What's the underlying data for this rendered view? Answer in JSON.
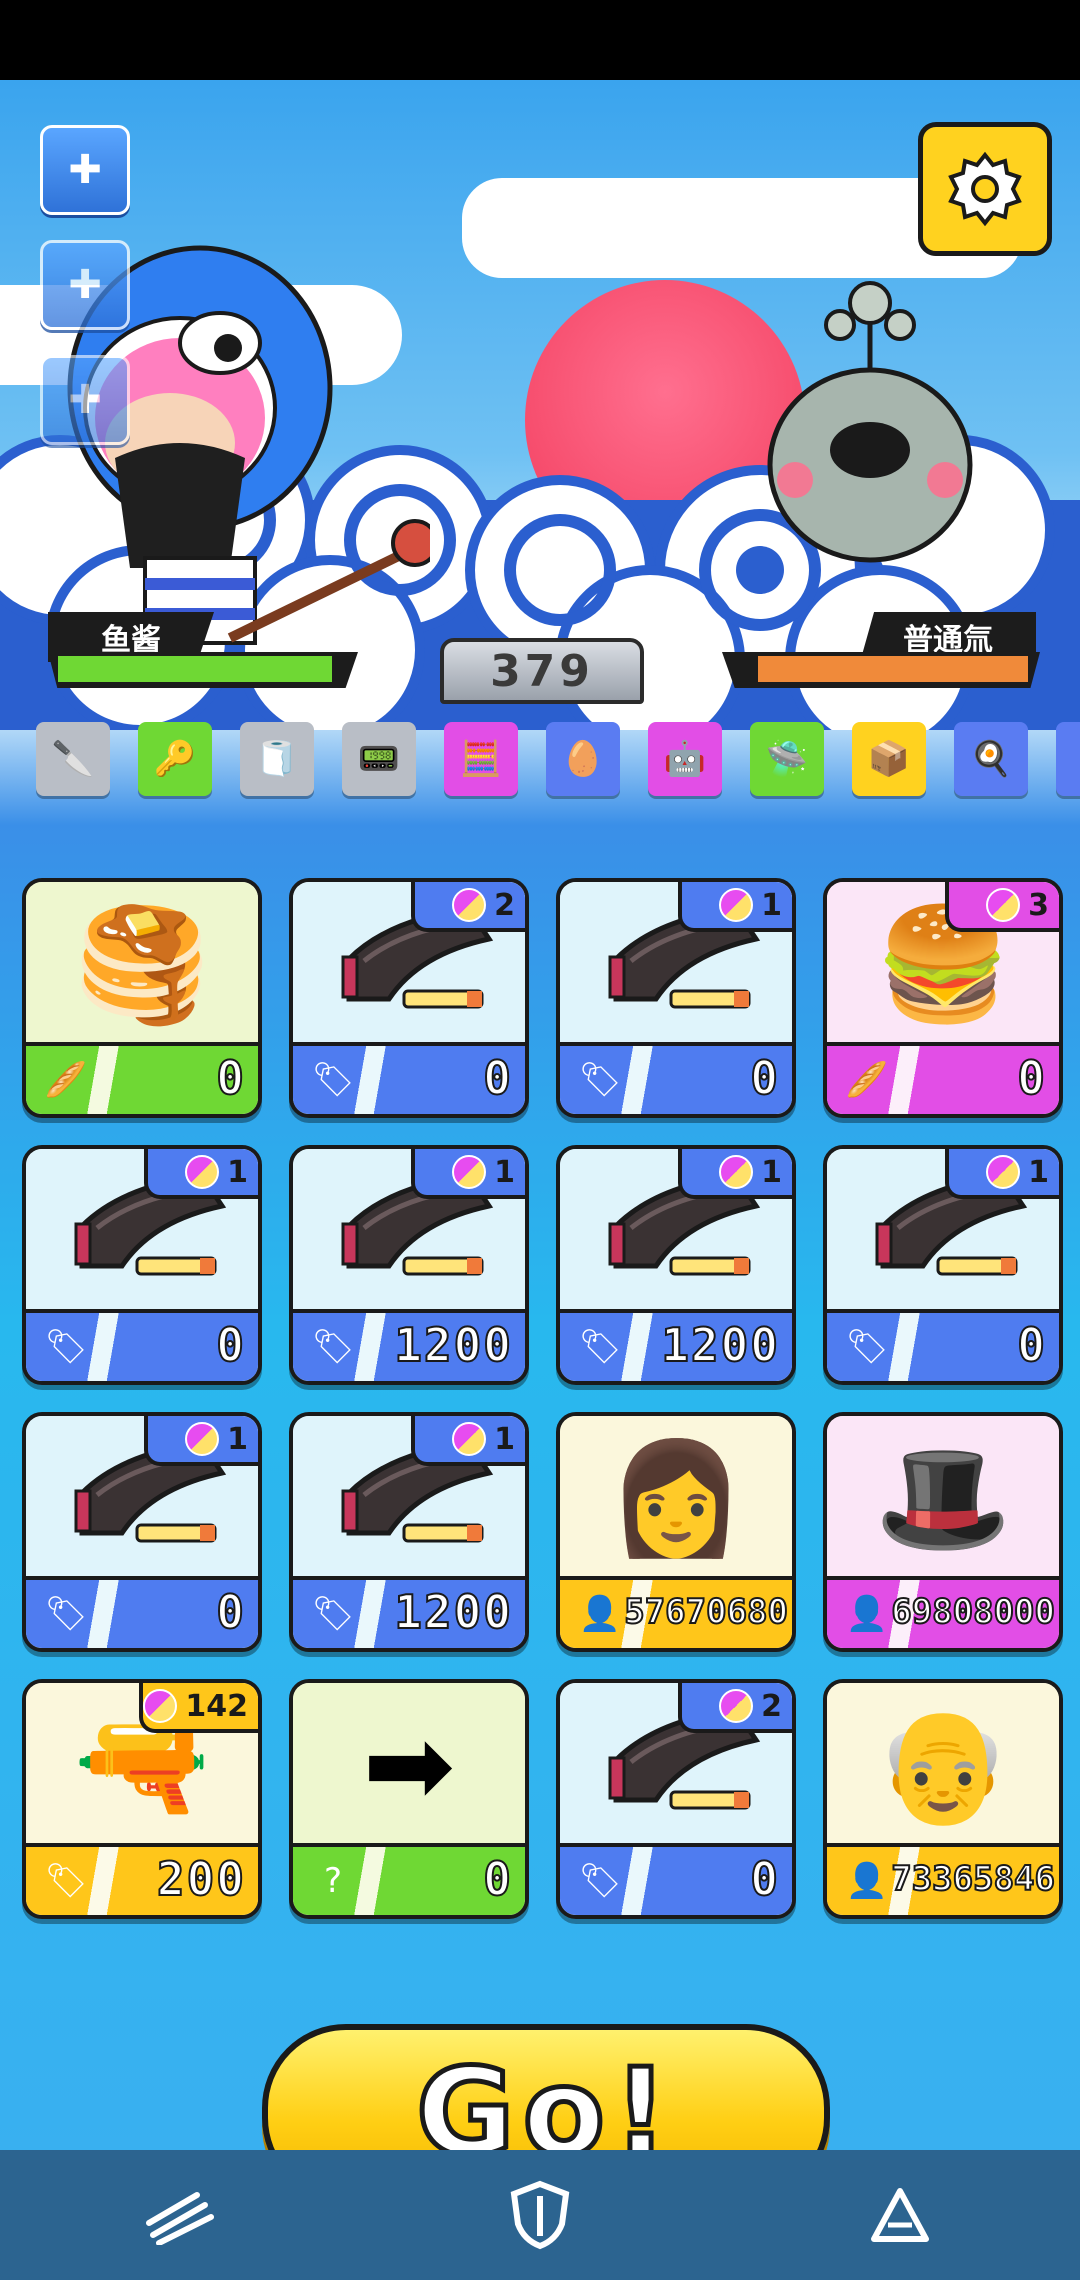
{
  "game": {
    "player_name": "鱼酱",
    "enemy_name": "普通氚",
    "score": "379",
    "player_hp_fraction": 0.95,
    "enemy_hp_fraction": 0.93,
    "go_label": "Go!"
  },
  "side_buttons": [
    {
      "name": "add-button-1",
      "icon": "plus-icon"
    },
    {
      "name": "add-button-2",
      "icon": "plus-icon"
    },
    {
      "name": "add-button-3",
      "icon": "plus-icon"
    }
  ],
  "tools": [
    {
      "name": "cleaver-tool",
      "glyph": "🔪",
      "color": "#b9bec6"
    },
    {
      "name": "key-tool",
      "glyph": "🔑",
      "color": "#6fd834"
    },
    {
      "name": "roll-tool",
      "glyph": "🧻",
      "color": "#b9bec6"
    },
    {
      "name": "circuit-tool",
      "glyph": "📟",
      "color": "#b9bec6"
    },
    {
      "name": "calculator-tool",
      "glyph": "🧮",
      "color": "#e24ee6"
    },
    {
      "name": "nest-tool",
      "glyph": "🥚",
      "color": "#5a7cf2"
    },
    {
      "name": "robot-tool",
      "glyph": "🤖",
      "color": "#e24ee6"
    },
    {
      "name": "drone-tool",
      "glyph": "🛸",
      "color": "#6fd834"
    },
    {
      "name": "ammo-box-tool",
      "glyph": "📦",
      "color": "#ffd21f"
    },
    {
      "name": "pan-tool",
      "glyph": "🍳",
      "color": "#5a7cf2"
    },
    {
      "name": "extra-tool",
      "glyph": "🧃",
      "color": "#5a7cf2"
    }
  ],
  "cards": [
    {
      "name": "pancake-card",
      "theme": "green",
      "art": "🥞",
      "icon": "bread-icon",
      "icon_glyph": "🥖",
      "value": "0",
      "badge": ""
    },
    {
      "name": "magazine-card",
      "theme": "blue",
      "art": "mag",
      "icon": "tag-icon",
      "icon_glyph": "🏷",
      "value": "0",
      "badge": "2"
    },
    {
      "name": "magazine-card",
      "theme": "blue",
      "art": "mag",
      "icon": "tag-icon",
      "icon_glyph": "🏷",
      "value": "0",
      "badge": "1"
    },
    {
      "name": "burger-card",
      "theme": "pink",
      "art": "🍔",
      "icon": "bread-icon",
      "icon_glyph": "🥖",
      "value": "0",
      "badge": "3"
    },
    {
      "name": "magazine-card",
      "theme": "blue",
      "art": "mag",
      "icon": "tag-icon",
      "icon_glyph": "🏷",
      "value": "0",
      "badge": "1"
    },
    {
      "name": "magazine-card",
      "theme": "blue",
      "art": "mag",
      "icon": "tag-icon",
      "icon_glyph": "🏷",
      "value": "1200",
      "badge": "1"
    },
    {
      "name": "magazine-card",
      "theme": "blue",
      "art": "mag",
      "icon": "tag-icon",
      "icon_glyph": "🏷",
      "value": "1200",
      "badge": "1"
    },
    {
      "name": "magazine-card",
      "theme": "blue",
      "art": "mag",
      "icon": "tag-icon",
      "icon_glyph": "🏷",
      "value": "0",
      "badge": "1"
    },
    {
      "name": "magazine-card",
      "theme": "blue",
      "art": "mag",
      "icon": "tag-icon",
      "icon_glyph": "🏷",
      "value": "0",
      "badge": "1"
    },
    {
      "name": "magazine-card",
      "theme": "blue",
      "art": "mag",
      "icon": "tag-icon",
      "icon_glyph": "🏷",
      "value": "1200",
      "badge": "1"
    },
    {
      "name": "girl-character-card",
      "theme": "yellow",
      "art": "👩",
      "icon": "person-icon",
      "icon_glyph": "👤",
      "value": "57670680",
      "badge": ""
    },
    {
      "name": "gentleman-character-card",
      "theme": "pink",
      "art": "🎩",
      "icon": "person-icon",
      "icon_glyph": "👤",
      "value": "69808000",
      "badge": ""
    },
    {
      "name": "gatling-gun-card",
      "theme": "yellow",
      "art": "🔫",
      "icon": "tag-icon",
      "icon_glyph": "🏷",
      "value": "200",
      "badge": "142"
    },
    {
      "name": "red-arrow-card",
      "theme": "green",
      "art": "➡",
      "icon": "question-icon",
      "icon_glyph": "?",
      "value": "0",
      "badge": ""
    },
    {
      "name": "magazine-card",
      "theme": "blue",
      "art": "mag",
      "icon": "tag-icon",
      "icon_glyph": "🏷",
      "value": "0",
      "badge": "2"
    },
    {
      "name": "scientist-character-card",
      "theme": "yellow",
      "art": "👴",
      "icon": "person-icon",
      "icon_glyph": "👤",
      "value": "73365846",
      "badge": ""
    }
  ],
  "themes": {
    "green": {
      "top": "#eef7cf",
      "bottom": "#6fd834",
      "badge": "#6fd834"
    },
    "blue": {
      "top": "#dff4fb",
      "bottom": "#4f7cf0",
      "badge": "#4f7cf0"
    },
    "pink": {
      "top": "#fbe6f7",
      "bottom": "#e24ee6",
      "badge": "#e24ee6"
    },
    "yellow": {
      "top": "#fbf7dc",
      "bottom": "#ffc61a",
      "badge": "#ffc61a"
    }
  },
  "nav": [
    {
      "name": "nav-attack",
      "icon": "slash-icon"
    },
    {
      "name": "nav-shield",
      "icon": "shield-icon"
    },
    {
      "name": "nav-triangle",
      "icon": "triangle-icon"
    }
  ]
}
